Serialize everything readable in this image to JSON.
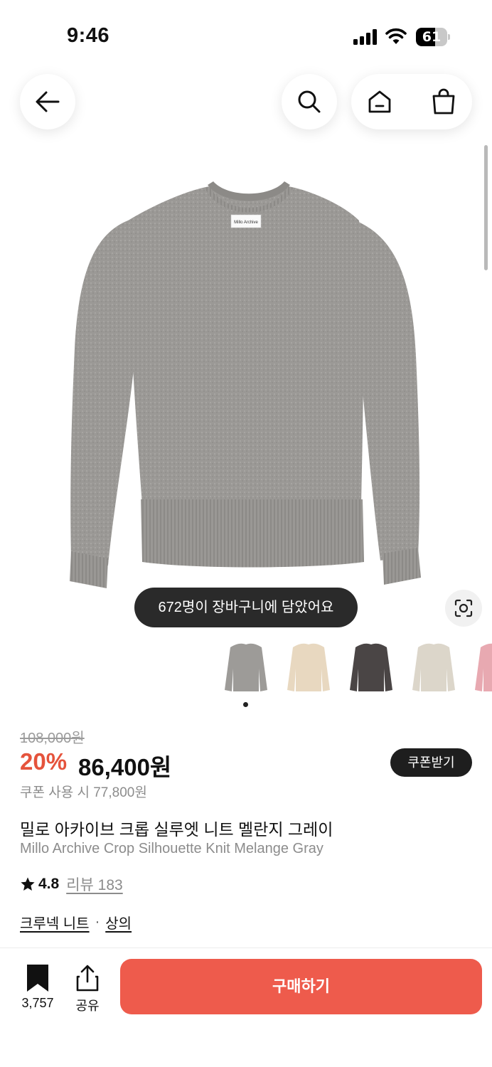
{
  "status_bar": {
    "time": "9:46",
    "battery_level": "61"
  },
  "nav": {
    "back_icon": "arrow-left-icon",
    "search_icon": "search-icon",
    "home_icon": "home-icon",
    "bag_icon": "shopping-bag-icon"
  },
  "product": {
    "image_label": "Millo Archive",
    "cart_toast": "672명이 장바구니에 담았어요",
    "color_thumbnails": [
      "gray",
      "beige",
      "charcoal",
      "oatmeal",
      "pink"
    ],
    "thumbnail_colors": [
      "#9d9b98",
      "#e8d8c0",
      "#4a4545",
      "#dcd6ca",
      "#e8a9b1"
    ],
    "original_price": "108,000원",
    "discount_rate": "20%",
    "sale_price": "86,400원",
    "coupon_button": "쿠폰받기",
    "coupon_price": "쿠폰 사용 시 77,800원",
    "title_ko": "밀로 아카이브 크롭 실루엣 니트 멜란지 그레이",
    "title_en": "Millo Archive Crop Silhouette Knit Melange Gray",
    "rating": "4.8",
    "review_link": "리뷰 183",
    "categories": [
      "크루넥 니트",
      "상의"
    ],
    "category_separator": "·"
  },
  "bottom_bar": {
    "bookmark_count": "3,757",
    "share_label": "공유",
    "buy_label": "구매하기"
  },
  "colors": {
    "accent": "#e5533c",
    "buy_button": "#ee5b4c",
    "dark": "#1e1e1e"
  }
}
